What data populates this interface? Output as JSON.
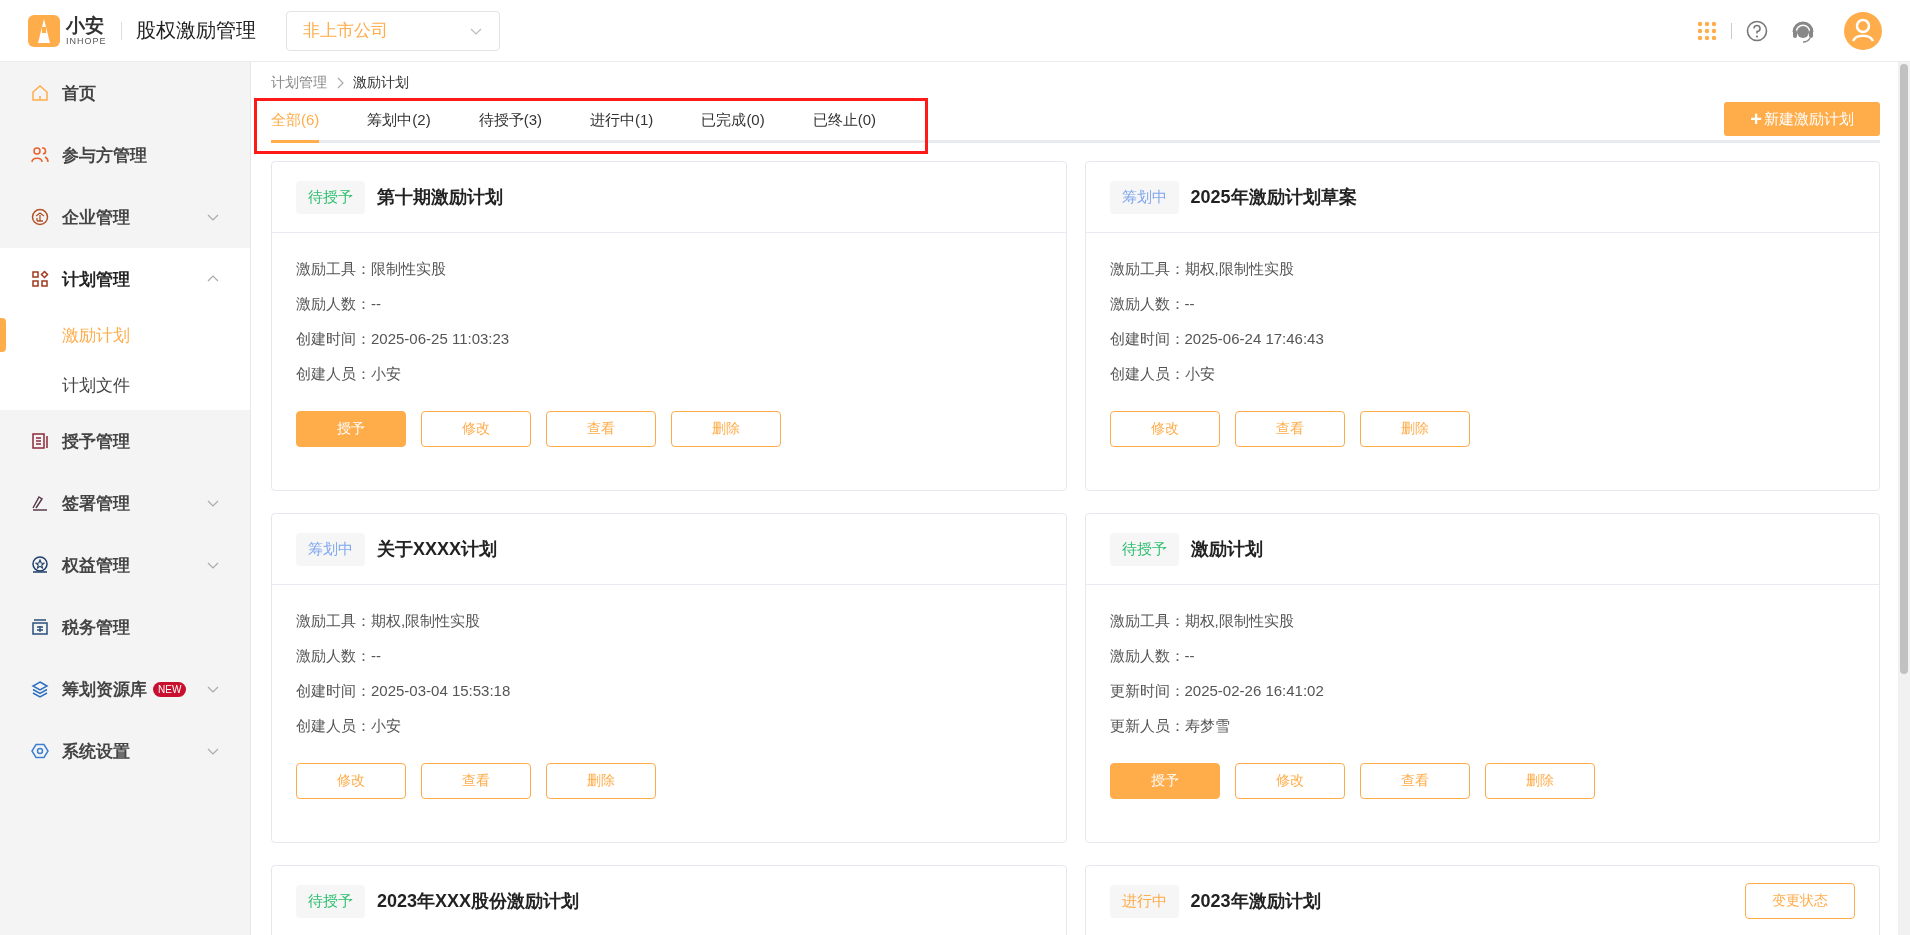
{
  "header": {
    "logo_text": "小安",
    "logo_subtext": "INHOPE",
    "app_title": "股权激励管理",
    "company_select": {
      "value": "非上市公司"
    }
  },
  "sidebar": {
    "items": [
      {
        "label": "首页"
      },
      {
        "label": "参与方管理"
      },
      {
        "label": "企业管理",
        "expanded": false
      },
      {
        "label": "计划管理",
        "expanded": true,
        "children": [
          {
            "label": "激励计划",
            "selected": true
          },
          {
            "label": "计划文件",
            "selected": false
          }
        ]
      },
      {
        "label": "授予管理"
      },
      {
        "label": "签署管理",
        "expanded": false
      },
      {
        "label": "权益管理",
        "expanded": false
      },
      {
        "label": "税务管理"
      },
      {
        "label": "筹划资源库",
        "badge": "NEW",
        "expanded": false
      },
      {
        "label": "系统设置",
        "expanded": false
      }
    ]
  },
  "breadcrumb": [
    "计划管理",
    "激励计划"
  ],
  "tabs": [
    {
      "label": "全部(6)",
      "selected": true
    },
    {
      "label": "筹划中(2)",
      "selected": false
    },
    {
      "label": "待授予(3)",
      "selected": false
    },
    {
      "label": "进行中(1)",
      "selected": false
    },
    {
      "label": "已完成(0)",
      "selected": false
    },
    {
      "label": "已终止(0)",
      "selected": false
    }
  ],
  "new_button": {
    "icon": "+",
    "label": "新建激励计划"
  },
  "cards": [
    {
      "status": "待授予",
      "color": "#2fbf71",
      "title": "第十期激励计划",
      "fields": [
        "激励工具：限制性实股",
        "激励人数：--",
        "创建时间：2025-06-25 11:03:23",
        "创建人员：小安"
      ],
      "buttons": [
        {
          "label": "授予",
          "kind": "primary"
        },
        {
          "label": "修改",
          "kind": "outline"
        },
        {
          "label": "查看",
          "kind": "outline"
        },
        {
          "label": "删除",
          "kind": "outline"
        }
      ]
    },
    {
      "status": "筹划中",
      "color": "#7fa7ef",
      "title": "2025年激励计划草案",
      "fields": [
        "激励工具：期权,限制性实股",
        "激励人数：--",
        "创建时间：2025-06-24 17:46:43",
        "创建人员：小安"
      ],
      "buttons": [
        {
          "label": "修改",
          "kind": "outline"
        },
        {
          "label": "查看",
          "kind": "outline"
        },
        {
          "label": "删除",
          "kind": "outline"
        }
      ]
    },
    {
      "status": "筹划中",
      "color": "#7fa7ef",
      "title": "关于XXXX计划",
      "fields": [
        "激励工具：期权,限制性实股",
        "激励人数：--",
        "创建时间：2025-03-04 15:53:18",
        "创建人员：小安"
      ],
      "buttons": [
        {
          "label": "修改",
          "kind": "outline"
        },
        {
          "label": "查看",
          "kind": "outline"
        },
        {
          "label": "删除",
          "kind": "outline"
        }
      ]
    },
    {
      "status": "待授予",
      "color": "#2fbf71",
      "title": "激励计划",
      "fields": [
        "激励工具：期权,限制性实股",
        "激励人数：--",
        "更新时间：2025-02-26 16:41:02",
        "更新人员：寿梦雪"
      ],
      "buttons": [
        {
          "label": "授予",
          "kind": "primary"
        },
        {
          "label": "修改",
          "kind": "outline"
        },
        {
          "label": "查看",
          "kind": "outline"
        },
        {
          "label": "删除",
          "kind": "outline"
        }
      ]
    },
    {
      "status": "待授予",
      "color": "#2fbf71",
      "title": "2023年XXX股份激励计划"
    },
    {
      "status": "进行中",
      "color": "#ffac4a",
      "title": "2023年激励计划",
      "header_button": "变更状态"
    }
  ]
}
